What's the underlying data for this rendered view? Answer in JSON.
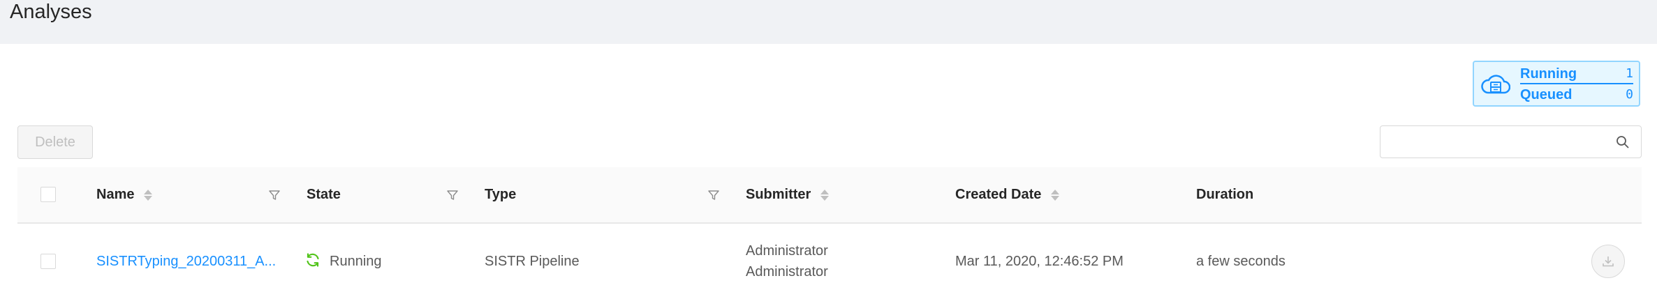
{
  "page": {
    "title": "Analyses"
  },
  "queue_status": {
    "running_label": "Running",
    "running_count": "1",
    "queued_label": "Queued",
    "queued_count": "0"
  },
  "toolbar": {
    "delete_label": "Delete",
    "search_placeholder": ""
  },
  "table": {
    "columns": {
      "name": "Name",
      "state": "State",
      "type": "Type",
      "submitter": "Submitter",
      "created_date": "Created Date",
      "duration": "Duration"
    },
    "rows": [
      {
        "name": "SISTRTyping_20200311_A...",
        "state": "Running",
        "type": "SISTR Pipeline",
        "submitter_first": "Administrator",
        "submitter_last": "Administrator",
        "created_date": "Mar 11, 2020, 12:46:52 PM",
        "duration": "a few seconds"
      }
    ]
  },
  "colors": {
    "accent": "#1890ff",
    "running": "#52c41a",
    "header_bg": "#f0f2f5"
  }
}
